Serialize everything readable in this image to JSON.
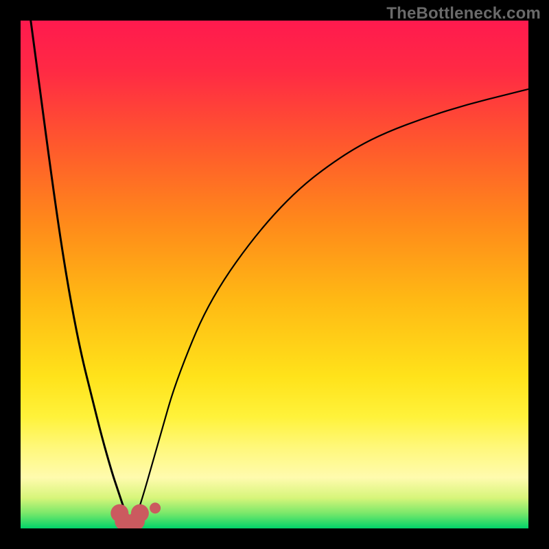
{
  "watermark_text": "TheBottleneck.com",
  "chart_data": {
    "type": "line",
    "title": "",
    "xlabel": "",
    "ylabel": "",
    "xlim": [
      0,
      100
    ],
    "ylim": [
      0,
      100
    ],
    "x_optimum": 22,
    "series": [
      {
        "name": "left-branch",
        "x": [
          2,
          4,
          6,
          8,
          10,
          12,
          14,
          16,
          18,
          19,
          20,
          21,
          22
        ],
        "values": [
          100,
          85,
          70,
          56,
          44,
          34,
          26,
          18,
          11,
          8,
          5,
          2,
          0
        ]
      },
      {
        "name": "right-branch",
        "x": [
          22,
          24,
          26,
          28,
          30,
          33,
          36,
          40,
          45,
          50,
          55,
          60,
          66,
          72,
          80,
          88,
          96,
          100
        ],
        "values": [
          0,
          6,
          13,
          20,
          27,
          35,
          42,
          49,
          56,
          62,
          67,
          71,
          75,
          78,
          81,
          83.5,
          85.5,
          86.5
        ]
      }
    ],
    "markers": [
      {
        "name": "arc-left-end",
        "x": 19.5,
        "y": 3.0,
        "r": 13
      },
      {
        "name": "arc-bottom-a",
        "x": 20.3,
        "y": 1.4,
        "r": 13
      },
      {
        "name": "arc-bottom-b",
        "x": 21.5,
        "y": 0.8,
        "r": 13
      },
      {
        "name": "arc-bottom-c",
        "x": 22.7,
        "y": 1.4,
        "r": 13
      },
      {
        "name": "arc-right-end",
        "x": 23.5,
        "y": 3.0,
        "r": 13
      },
      {
        "name": "dot-right",
        "x": 26.5,
        "y": 4.0,
        "r": 8
      }
    ],
    "marker_color": "#cb5a5f",
    "curve_color": "#000000",
    "gradient_stops": [
      {
        "offset": 0.0,
        "color": "#ff1a4e"
      },
      {
        "offset": 0.1,
        "color": "#ff2a44"
      },
      {
        "offset": 0.25,
        "color": "#ff5a2c"
      },
      {
        "offset": 0.4,
        "color": "#ff8a1a"
      },
      {
        "offset": 0.55,
        "color": "#ffb914"
      },
      {
        "offset": 0.7,
        "color": "#ffe21a"
      },
      {
        "offset": 0.78,
        "color": "#fff23a"
      },
      {
        "offset": 0.84,
        "color": "#fff87a"
      },
      {
        "offset": 0.9,
        "color": "#fffbae"
      },
      {
        "offset": 0.94,
        "color": "#d7f57a"
      },
      {
        "offset": 0.97,
        "color": "#7ae86a"
      },
      {
        "offset": 1.0,
        "color": "#01d46a"
      }
    ]
  }
}
